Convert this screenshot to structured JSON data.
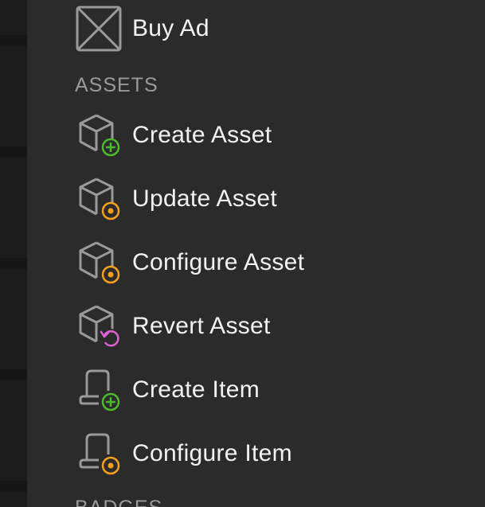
{
  "menu": {
    "buy_ad": {
      "label": "Buy Ad",
      "icon": "placeholder-image-icon"
    },
    "sections": [
      {
        "title": "ASSETS",
        "items": [
          {
            "label": "Create Asset",
            "icon": "cube-add-icon",
            "badge_color": "#4cba2a"
          },
          {
            "label": "Update Asset",
            "icon": "cube-update-icon",
            "badge_color": "#f5a01a"
          },
          {
            "label": "Configure Asset",
            "icon": "cube-configure-icon",
            "badge_color": "#f5a01a"
          },
          {
            "label": "Revert Asset",
            "icon": "cube-revert-icon",
            "badge_color": "#e060d8"
          },
          {
            "label": "Create Item",
            "icon": "scroll-add-icon",
            "badge_color": "#4cba2a"
          },
          {
            "label": "Configure Item",
            "icon": "scroll-configure-icon",
            "badge_color": "#f5a01a"
          }
        ]
      },
      {
        "title": "BADGES"
      }
    ]
  },
  "colors": {
    "menu_bg": "#2b2b2b",
    "text": "#f2f2f2",
    "section_text": "#9a9a9a",
    "icon_stroke": "#9a9a9a",
    "add_green": "#4cba2a",
    "update_orange": "#f5a01a",
    "revert_pink": "#e060d8"
  }
}
